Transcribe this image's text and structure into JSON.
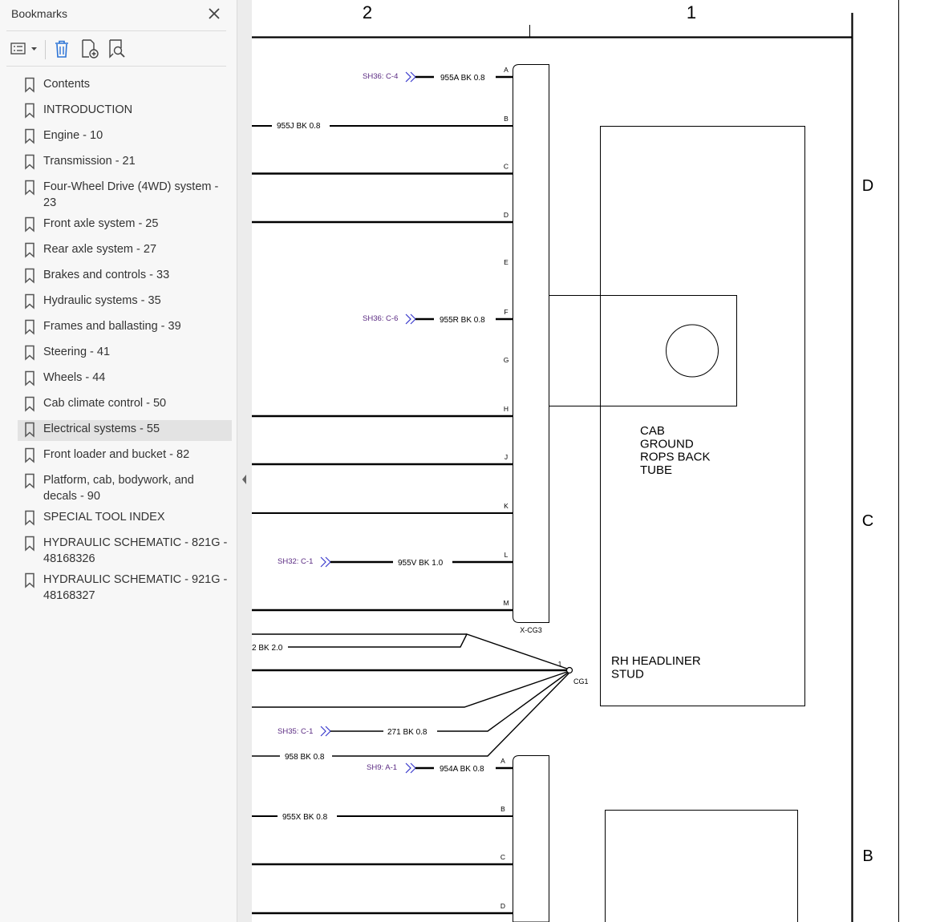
{
  "sidebar": {
    "title": "Bookmarks",
    "close_icon": "close-icon",
    "toolbar": {
      "options_icon": "list-options-icon",
      "delete_icon": "trash-icon",
      "add_icon": "add-bookmark-icon",
      "search_icon": "search-bookmark-icon"
    },
    "bookmarks": [
      {
        "label": "Contents"
      },
      {
        "label": "INTRODUCTION"
      },
      {
        "label": "Engine - 10"
      },
      {
        "label": "Transmission - 21"
      },
      {
        "label": "Four-Wheel Drive (4WD) system - 23"
      },
      {
        "label": "Front axle system - 25"
      },
      {
        "label": "Rear axle system - 27"
      },
      {
        "label": "Brakes and controls - 33"
      },
      {
        "label": "Hydraulic systems - 35"
      },
      {
        "label": "Frames and ballasting - 39"
      },
      {
        "label": "Steering - 41"
      },
      {
        "label": "Wheels - 44"
      },
      {
        "label": "Cab climate control - 50"
      },
      {
        "label": "Electrical systems - 55",
        "selected": true
      },
      {
        "label": "Front loader and bucket - 82"
      },
      {
        "label": "Platform, cab, bodywork, and decals - 90"
      },
      {
        "label": "SPECIAL TOOL INDEX"
      },
      {
        "label": "HYDRAULIC SCHEMATIC - 821G - 48168326"
      },
      {
        "label": "HYDRAULIC SCHEMATIC - 921G - 48168327"
      }
    ]
  },
  "schematic": {
    "colors": {
      "ref": "#5a2a82",
      "arrow": "#3a3acc",
      "line": "#000000"
    },
    "columns": [
      "2",
      "1"
    ],
    "rows": [
      "D",
      "C",
      "B"
    ],
    "connector_top": {
      "name": "X-CG3",
      "pins": [
        {
          "pin": "A",
          "ref": "SH36: C-4",
          "wire": "955A BK 0.8"
        },
        {
          "pin": "B",
          "ref": "",
          "wire": "955J BK 0.8"
        },
        {
          "pin": "C",
          "ref": "",
          "wire": ""
        },
        {
          "pin": "D",
          "ref": "",
          "wire": ""
        },
        {
          "pin": "E",
          "ref": "",
          "wire": ""
        },
        {
          "pin": "F",
          "ref": "SH36: C-6",
          "wire": "955R BK 0.8"
        },
        {
          "pin": "G",
          "ref": "",
          "wire": ""
        },
        {
          "pin": "H",
          "ref": "",
          "wire": ""
        },
        {
          "pin": "J",
          "ref": "",
          "wire": ""
        },
        {
          "pin": "K",
          "ref": "",
          "wire": ""
        },
        {
          "pin": "L",
          "ref": "SH32: C-1",
          "wire": "955V BK 1.0"
        },
        {
          "pin": "M",
          "ref": "",
          "wire": ""
        }
      ]
    },
    "ground_label_1": [
      "CAB",
      "GROUND",
      "ROPS BACK",
      "TUBE"
    ],
    "ground_label_2": [
      "RH HEADLINER",
      "STUD"
    ],
    "ground": {
      "name": "CG1",
      "pin": "1"
    },
    "splice_wires": [
      {
        "ref": "",
        "wire": "2 BK 2.0"
      },
      {
        "ref": "SH35: C-1",
        "wire": "271 BK 0.8"
      },
      {
        "ref": "",
        "wire": "958 BK 0.8"
      }
    ],
    "connector_bottom": {
      "pins": [
        {
          "pin": "A",
          "ref": "SH9: A-1",
          "wire": "954A BK 0.8"
        },
        {
          "pin": "B",
          "ref": "",
          "wire": "955X BK 0.8"
        },
        {
          "pin": "C",
          "ref": "",
          "wire": ""
        },
        {
          "pin": "D",
          "ref": "",
          "wire": ""
        }
      ]
    }
  }
}
